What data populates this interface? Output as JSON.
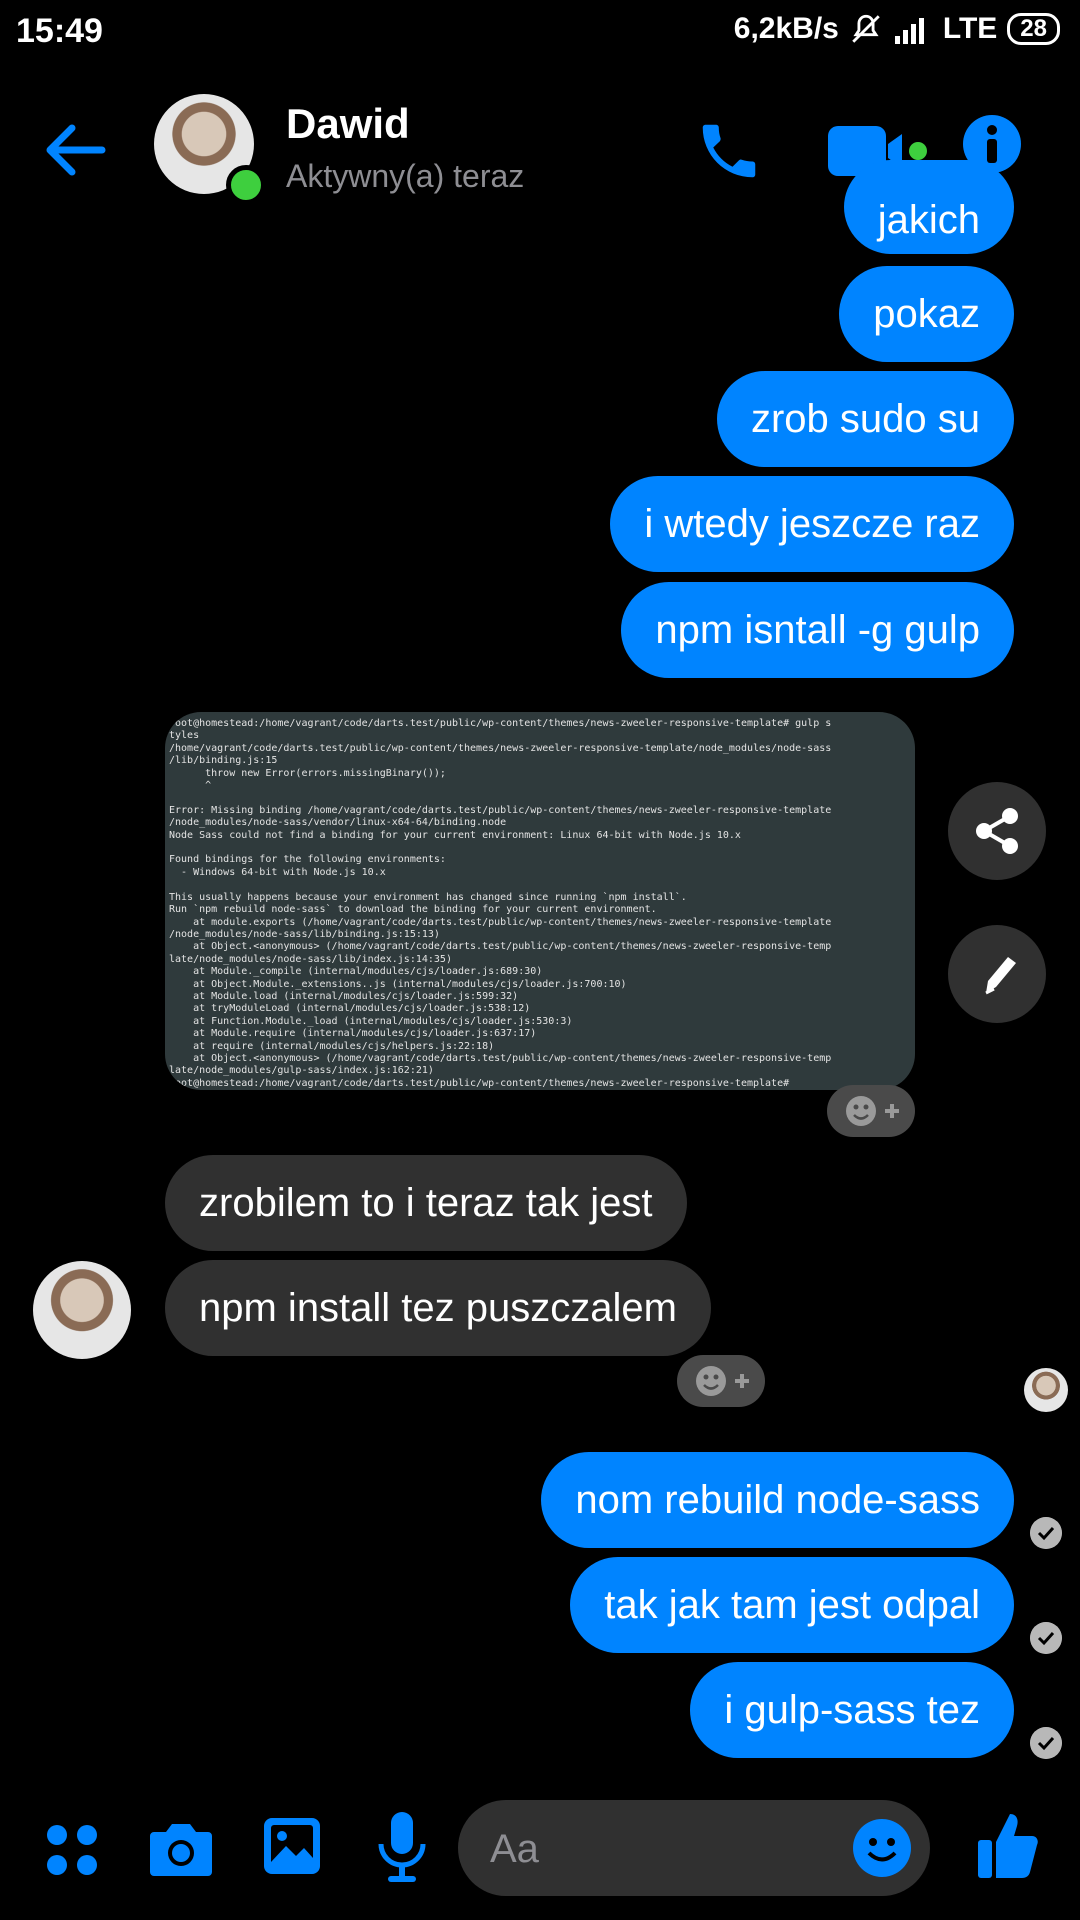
{
  "status_bar": {
    "time": "15:49",
    "network_speed": "6,2kB/s",
    "network": "LTE",
    "battery": "28",
    "icons": [
      "mute-icon",
      "signal-icon"
    ]
  },
  "header": {
    "contact_name": "Dawid",
    "contact_status": "Aktywny(a) teraz",
    "icons": [
      "back-arrow-icon",
      "phone-icon",
      "video-camera-icon",
      "info-icon"
    ],
    "accent_color": "#0084ff",
    "online_color": "#3ecf3e"
  },
  "messages": {
    "outgoing_top": [
      {
        "text": "jakich"
      },
      {
        "text": "pokaz"
      },
      {
        "text": "zrob sudo su"
      },
      {
        "text": "i wtedy jeszcze raz"
      },
      {
        "text": "npm isntall -g gulp"
      }
    ],
    "terminal_lines": [
      "root@homestead:/home/vagrant/code/darts.test/public/wp-content/themes/news-zweeler-responsive-template# gulp s",
      "tyles",
      "/home/vagrant/code/darts.test/public/wp-content/themes/news-zweeler-responsive-template/node_modules/node-sass",
      "/lib/binding.js:15",
      "      throw new Error(errors.missingBinary());",
      "      ^",
      "",
      "Error: Missing binding /home/vagrant/code/darts.test/public/wp-content/themes/news-zweeler-responsive-template",
      "/node_modules/node-sass/vendor/linux-x64-64/binding.node",
      "Node Sass could not find a binding for your current environment: Linux 64-bit with Node.js 10.x",
      "",
      "Found bindings for the following environments:",
      "  - Windows 64-bit with Node.js 10.x",
      "",
      "This usually happens because your environment has changed since running `npm install`.",
      "Run `npm rebuild node-sass` to download the binding for your current environment.",
      "    at module.exports (/home/vagrant/code/darts.test/public/wp-content/themes/news-zweeler-responsive-template",
      "/node_modules/node-sass/lib/binding.js:15:13)",
      "    at Object.<anonymous> (/home/vagrant/code/darts.test/public/wp-content/themes/news-zweeler-responsive-temp",
      "late/node_modules/node-sass/lib/index.js:14:35)",
      "    at Module._compile (internal/modules/cjs/loader.js:689:30)",
      "    at Object.Module._extensions..js (internal/modules/cjs/loader.js:700:10)",
      "    at Module.load (internal/modules/cjs/loader.js:599:32)",
      "    at tryModuleLoad (internal/modules/cjs/loader.js:538:12)",
      "    at Function.Module._load (internal/modules/cjs/loader.js:530:3)",
      "    at Module.require (internal/modules/cjs/loader.js:637:17)",
      "    at require (internal/modules/cjs/helpers.js:22:18)",
      "    at Object.<anonymous> (/home/vagrant/code/darts.test/public/wp-content/themes/news-zweeler-responsive-temp",
      "late/node_modules/gulp-sass/index.js:162:21)",
      "root@homestead:/home/vagrant/code/darts.test/public/wp-content/themes/news-zweeler-responsive-template# "
    ],
    "incoming": [
      {
        "text": "zrobilem to i teraz tak jest"
      },
      {
        "text": "npm install tez puszczalem"
      }
    ],
    "outgoing_bottom": [
      {
        "text": "nom rebuild node-sass"
      },
      {
        "text": "tak jak tam jest odpal"
      },
      {
        "text": "i gulp-sass tez"
      }
    ],
    "side_icons": [
      "share-icon",
      "edit-icon",
      "add-reaction-icon",
      "read-receipt-icon"
    ]
  },
  "composer": {
    "placeholder": "Aa",
    "icons": [
      "apps-icon",
      "camera-icon",
      "gallery-icon",
      "microphone-icon",
      "emoji-icon",
      "thumbs-up-icon"
    ]
  }
}
